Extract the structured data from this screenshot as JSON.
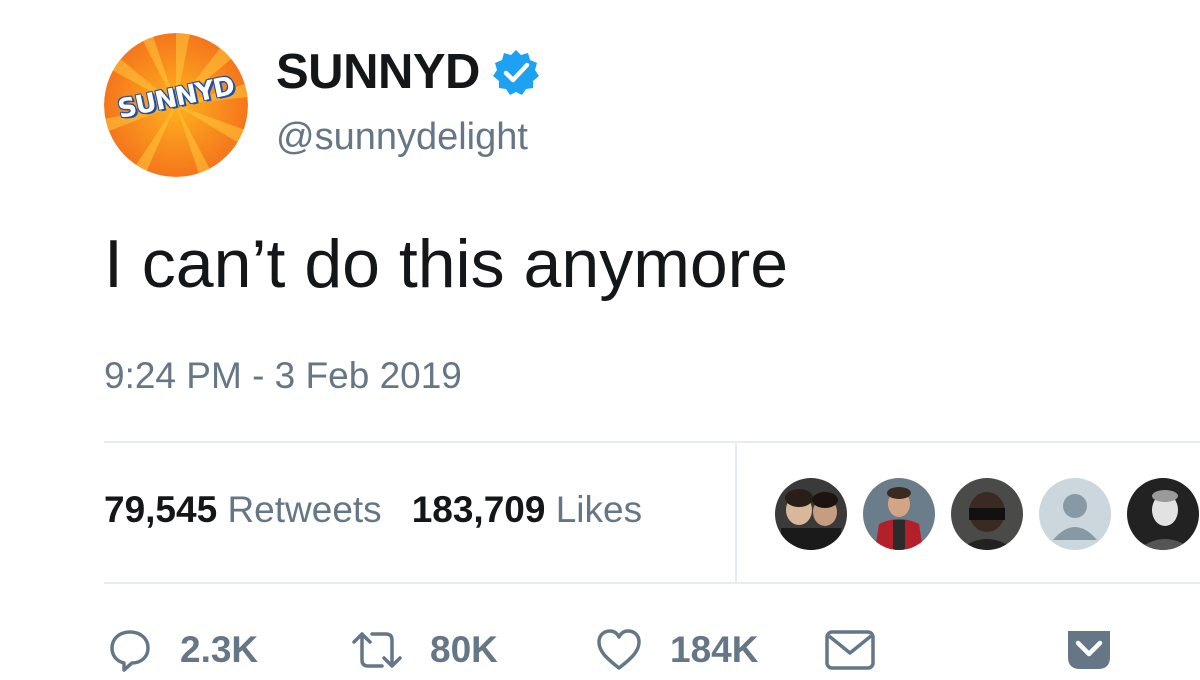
{
  "user": {
    "avatar_text": "SUNNYD",
    "display_name": "SUNNYD",
    "handle": "@sunnydelight",
    "verified": true,
    "avatar_colors": [
      "#f7a21b",
      "#f26a1b"
    ]
  },
  "tweet": {
    "text": "I can’t do this anymore",
    "timestamp": "9:24 PM - 3 Feb 2019"
  },
  "stats": {
    "retweets_count": "79,545",
    "retweets_label": "Retweets",
    "likes_count": "183,709",
    "likes_label": "Likes"
  },
  "likers": [
    {
      "name": "liker-avatar-1"
    },
    {
      "name": "liker-avatar-2"
    },
    {
      "name": "liker-avatar-3"
    },
    {
      "name": "liker-avatar-default"
    },
    {
      "name": "liker-avatar-5"
    }
  ],
  "actions": {
    "replies": "2.3K",
    "retweets": "80K",
    "likes": "184K"
  },
  "colors": {
    "verified": "#1da1f2",
    "secondary_text": "#657786",
    "divider": "#e6ecf0"
  },
  "icons": [
    "reply-icon",
    "retweet-icon",
    "like-icon",
    "direct-message-icon",
    "caret-down-icon",
    "verified-badge-icon"
  ]
}
